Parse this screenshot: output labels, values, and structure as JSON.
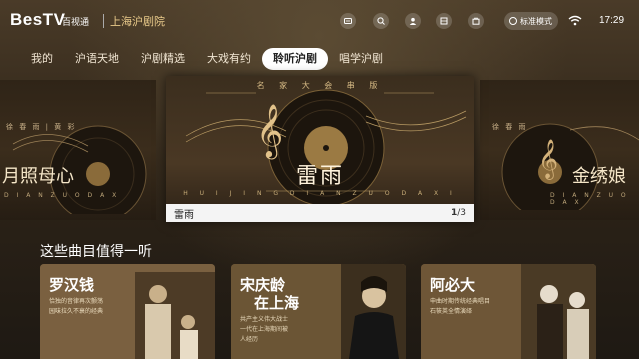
{
  "header": {
    "logo": "BesTV",
    "logo_sub": "百视通",
    "brand": "上海沪剧院",
    "mode_label": "标准模式",
    "time": "17:29",
    "icons": [
      "message-icon",
      "search-icon",
      "user-icon",
      "cube-icon",
      "bag-icon",
      "mode-icon",
      "wifi-icon"
    ]
  },
  "tabs": [
    {
      "label": "我的",
      "active": false
    },
    {
      "label": "沪语天地",
      "active": false
    },
    {
      "label": "沪剧精选",
      "active": false
    },
    {
      "label": "大戏有约",
      "active": false
    },
    {
      "label": "聆听沪剧",
      "active": true
    },
    {
      "label": "唱学沪剧",
      "active": false
    }
  ],
  "carousel": {
    "left": {
      "top": "徐 春 雨 | 黄 彩",
      "title": "月照母心",
      "pinyin": "D I A N Z U O D A X"
    },
    "main": {
      "header": "名 家 大 会 串 版",
      "title": "雷雨",
      "pinyin": "H U I J I N G D I A N Z U O D A X I"
    },
    "right": {
      "top": "徐 春 雨",
      "title": "金绣娘",
      "pinyin": "D I A N Z U O D A X"
    },
    "caption": {
      "name": "雷雨",
      "current": "1",
      "total": "/3"
    }
  },
  "section": {
    "title": "这些曲目值得一听",
    "cards": [
      {
        "title": "罗汉钱",
        "desc": [
          "恰独的音律再次颤荡",
          "园味拉久不衰的经典"
        ]
      },
      {
        "title1": "宋庆龄",
        "title2": "在上海",
        "desc": [
          "共产主义伟大战士",
          "一代在上海期间被",
          "人经历"
        ]
      },
      {
        "title": "阿必大",
        "desc": [
          "申曲时期传统经典唱目",
          "石筱英全情演绎"
        ]
      }
    ]
  },
  "colors": {
    "accent": "#e8c98a",
    "bg": "#2e2418",
    "active_tab": "#ffffff"
  }
}
